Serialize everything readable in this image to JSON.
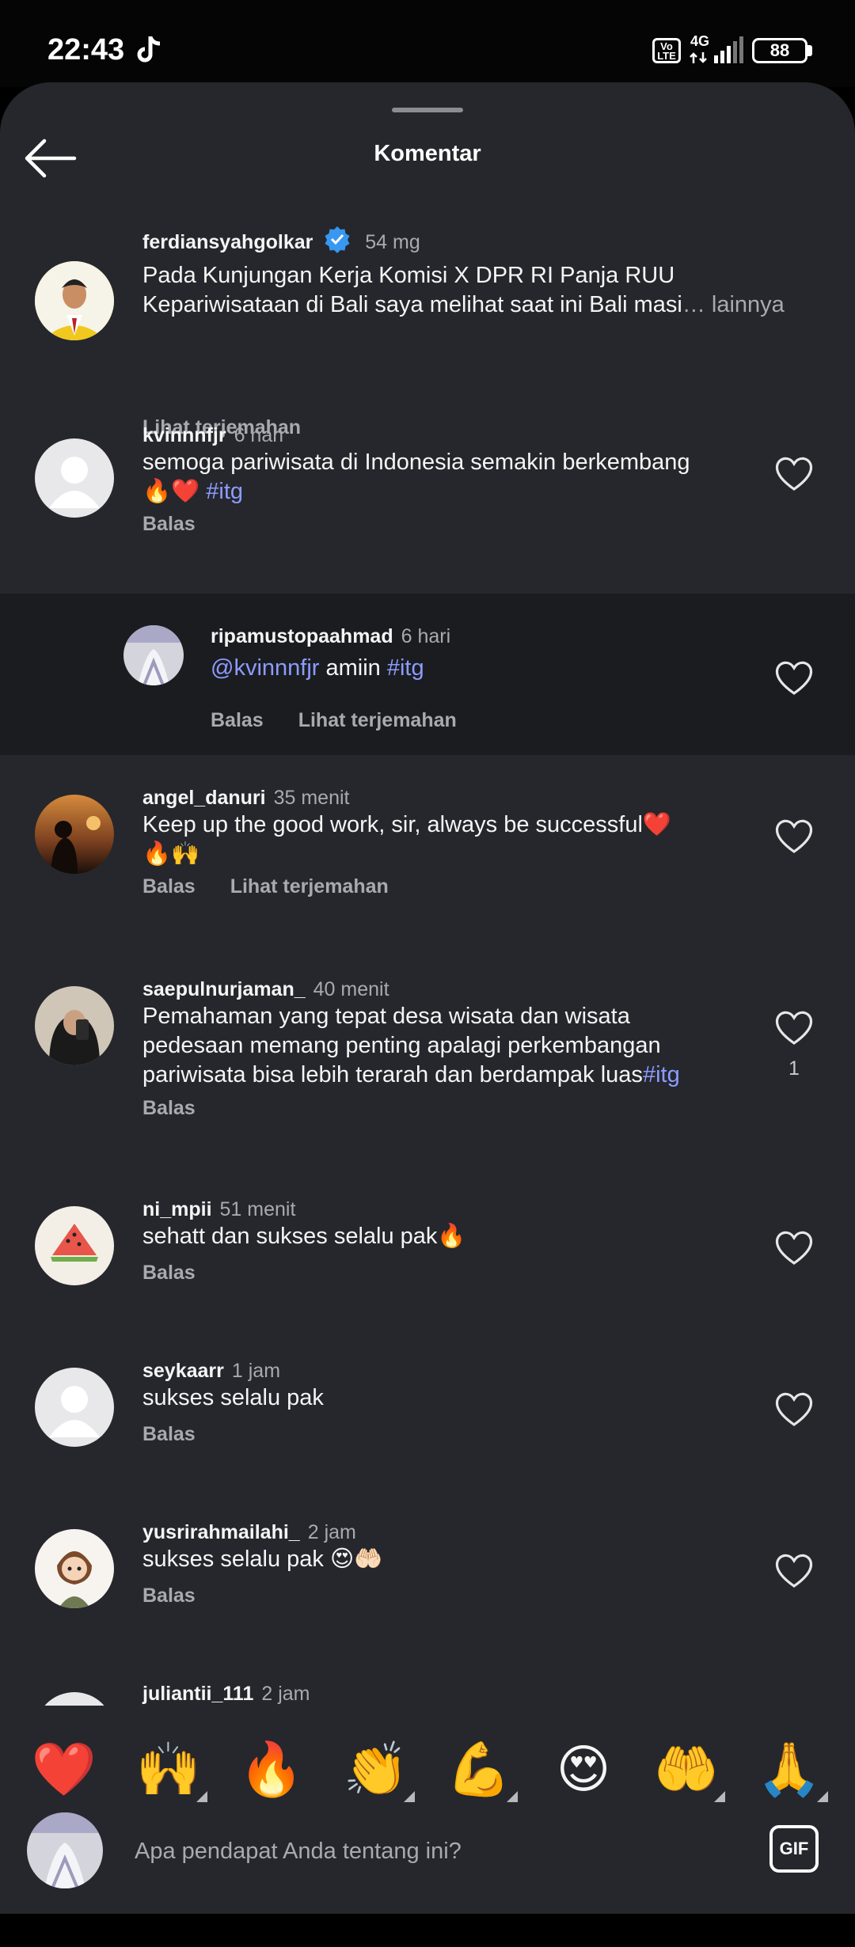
{
  "status_bar": {
    "time": "22:43",
    "network": "4G",
    "volte": "Vo LTE",
    "battery": "88"
  },
  "header": {
    "title": "Komentar"
  },
  "comments": [
    {
      "user": "ferdiansyahgolkar",
      "time": "54 mg",
      "verified": true,
      "text_1": "Pada Kunjungan Kerja Komisi X DPR RI Panja RUU",
      "text_2": "Kepariwisataan di Bali saya melihat saat ini Bali masi",
      "more": "… lainnya",
      "translate": "Lihat terjemahan"
    },
    {
      "user": "kvinnnfjr",
      "time": "6 hari",
      "text_1": "semoga pariwisata di Indonesia semakin berkembang",
      "emoji": "🔥❤️",
      "tag": "#itg",
      "reply": "Balas"
    },
    {
      "user": "ripamustopaahmad",
      "time": "6 hari",
      "mention": "@kvinnnfjr",
      "text": " amiin ",
      "tag": "#itg",
      "reply": "Balas",
      "translate": "Lihat terjemahan"
    },
    {
      "user": "angel_danuri",
      "time": "35 menit",
      "text_1": "Keep up the good work, sir, always be successful❤️",
      "text_2": "🔥🙌",
      "reply": "Balas",
      "translate": "Lihat terjemahan"
    },
    {
      "user": "saepulnurjaman_",
      "time": "40 menit",
      "text_1": "Pemahaman yang tepat desa wisata dan wisata",
      "text_2": "pedesaan memang penting apalagi perkembangan",
      "text_3": "pariwisata bisa lebih terarah dan berdampak luas",
      "tag": "#itg",
      "reply": "Balas",
      "likes": "1"
    },
    {
      "user": "ni_mpii",
      "time": "51 menit",
      "text_1": "sehatt dan sukses selalu pak🔥",
      "reply": "Balas"
    },
    {
      "user": "seykaarr",
      "time": "1 jam",
      "text_1": "sukses selalu pak",
      "reply": "Balas"
    },
    {
      "user": "yusrirahmailahi_",
      "time": "2 jam",
      "text_1": "sukses selalu pak 😍🤲🏻",
      "reply": "Balas"
    },
    {
      "user": "juliantii_111",
      "time": "2 jam"
    }
  ],
  "quick_emojis": [
    "❤️",
    "🙌",
    "🔥",
    "👏",
    "💪",
    "😍",
    "🤲",
    "🙏"
  ],
  "composer": {
    "placeholder": "Apa pendapat Anda tentang ini?",
    "gif_label": "GIF"
  },
  "colors": {
    "sheet": "#25272c",
    "highlight": "#1b1c20",
    "hashtag": "#8c9cff",
    "verified": "#3897f0"
  }
}
